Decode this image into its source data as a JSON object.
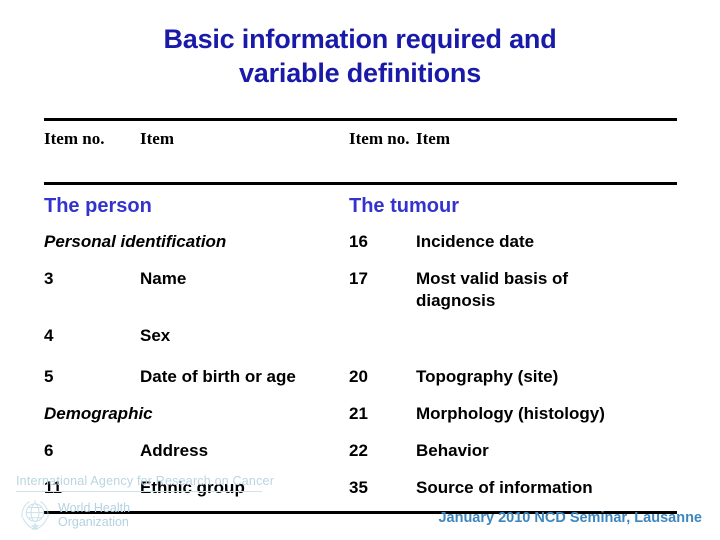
{
  "title": {
    "line1": "Basic information required and",
    "line2": "variable definitions",
    "color": "#1a1aa8"
  },
  "table": {
    "header": {
      "left_num": "Item no.",
      "left_item": "Item",
      "right_num": "Item no.",
      "right_item": "Item"
    },
    "sections": {
      "left": "The person",
      "right": "The tumour",
      "color": "#3434cc"
    },
    "rows": [
      {
        "left_group": "Personal identification",
        "left_num": "",
        "left_item": "",
        "right_num": "16",
        "right_item": "Incidence date"
      },
      {
        "left_group": "",
        "left_num": "3",
        "left_item": "Name",
        "right_num": "17",
        "right_item": "Most valid basis of diagnosis"
      },
      {
        "left_group": "",
        "left_num": "4",
        "left_item": "Sex",
        "right_num": "",
        "right_item": ""
      },
      {
        "left_group": "",
        "left_num": "5",
        "left_item": "Date of birth or age",
        "right_num": "20",
        "right_item": "Topography (site)"
      },
      {
        "left_group": "Demographic",
        "left_num": "",
        "left_item": "",
        "right_num": "21",
        "right_item": "Morphology (histology)"
      },
      {
        "left_group": "",
        "left_num": "6",
        "left_item": "Address",
        "right_num": "22",
        "right_item": "Behavior"
      },
      {
        "left_group": "",
        "left_num": "11",
        "left_item": "Ethnic group",
        "right_num": "35",
        "right_item": "Source of information"
      }
    ]
  },
  "footer": {
    "iarc": "International Agency for Research on Cancer",
    "who_line1": "World Health",
    "who_line2": "Organization",
    "note": "January 2010 NCD Seminar, Lausanne",
    "note_color": "#3d87c0",
    "logo_color": "#b9d5e4"
  }
}
